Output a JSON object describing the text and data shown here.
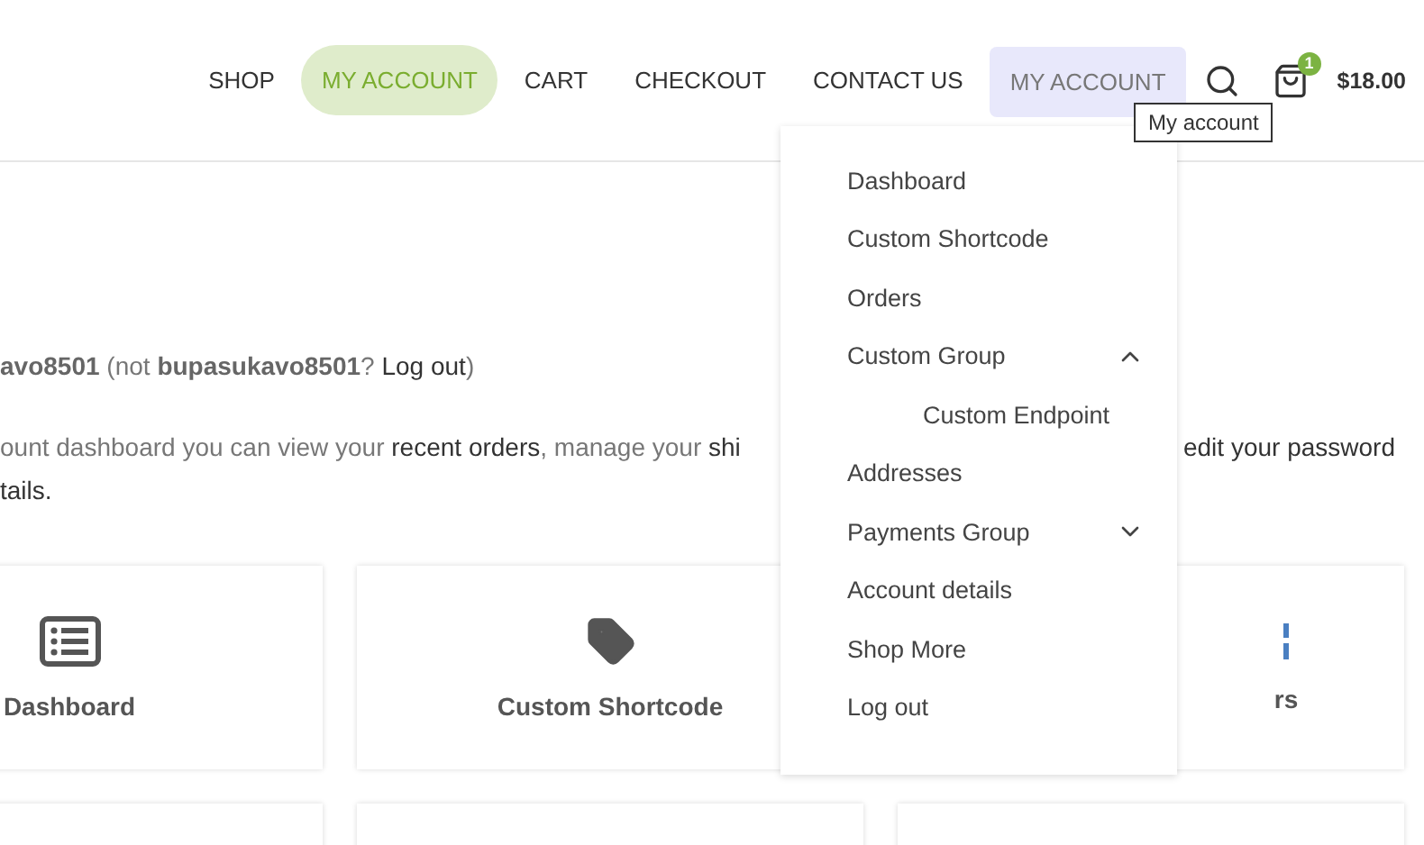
{
  "nav": [
    {
      "label": "SHOP",
      "selected": false,
      "open": false
    },
    {
      "label": "MY ACCOUNT",
      "selected": true,
      "open": false
    },
    {
      "label": "CART",
      "selected": false,
      "open": false
    },
    {
      "label": "CHECKOUT",
      "selected": false,
      "open": false
    },
    {
      "label": "CONTACT US",
      "selected": false,
      "open": false
    },
    {
      "label": "MY ACCOUNT",
      "selected": false,
      "open": true
    }
  ],
  "cart": {
    "count": "1",
    "total": "$18.00"
  },
  "tooltip": "My account",
  "greeting": [
    {
      "kind": "bold",
      "text": "avo8501"
    },
    {
      "kind": "plain",
      "text": " (not "
    },
    {
      "kind": "bold",
      "text": "bupasukavo8501"
    },
    {
      "kind": "plain",
      "text": "? "
    },
    {
      "kind": "link",
      "text": "Log out"
    },
    {
      "kind": "plain",
      "text": ")"
    }
  ],
  "intro": {
    "left": [
      {
        "kind": "plain",
        "text": "ount dashboard you can view your "
      },
      {
        "kind": "link",
        "text": "recent orders"
      },
      {
        "kind": "plain",
        "text": ", manage your "
      },
      {
        "kind": "link",
        "text": "shi"
      }
    ],
    "right": [
      {
        "kind": "link",
        "text": "edit your password"
      }
    ],
    "second": [
      {
        "kind": "link",
        "text": "tails."
      }
    ]
  },
  "cards": [
    {
      "kind": "list",
      "title": "Dashboard"
    },
    {
      "kind": "tag",
      "title": "Custom Shortcode"
    },
    {
      "kind": "partial",
      "title": "rs"
    }
  ],
  "lower_cards": [
    {
      "kind": "blank"
    },
    {
      "kind": "blank"
    },
    {
      "kind": "blank"
    }
  ],
  "menu": [
    {
      "label": "Dashboard"
    },
    {
      "label": "Custom Shortcode"
    },
    {
      "label": "Orders"
    },
    {
      "label": "Custom Group",
      "expanded": true,
      "children": [
        {
          "label": "Custom Endpoint"
        }
      ]
    },
    {
      "label": "Addresses"
    },
    {
      "label": "Payments Group",
      "expanded": false
    },
    {
      "label": "Account details"
    },
    {
      "label": "Shop More"
    },
    {
      "label": "Log out"
    }
  ]
}
